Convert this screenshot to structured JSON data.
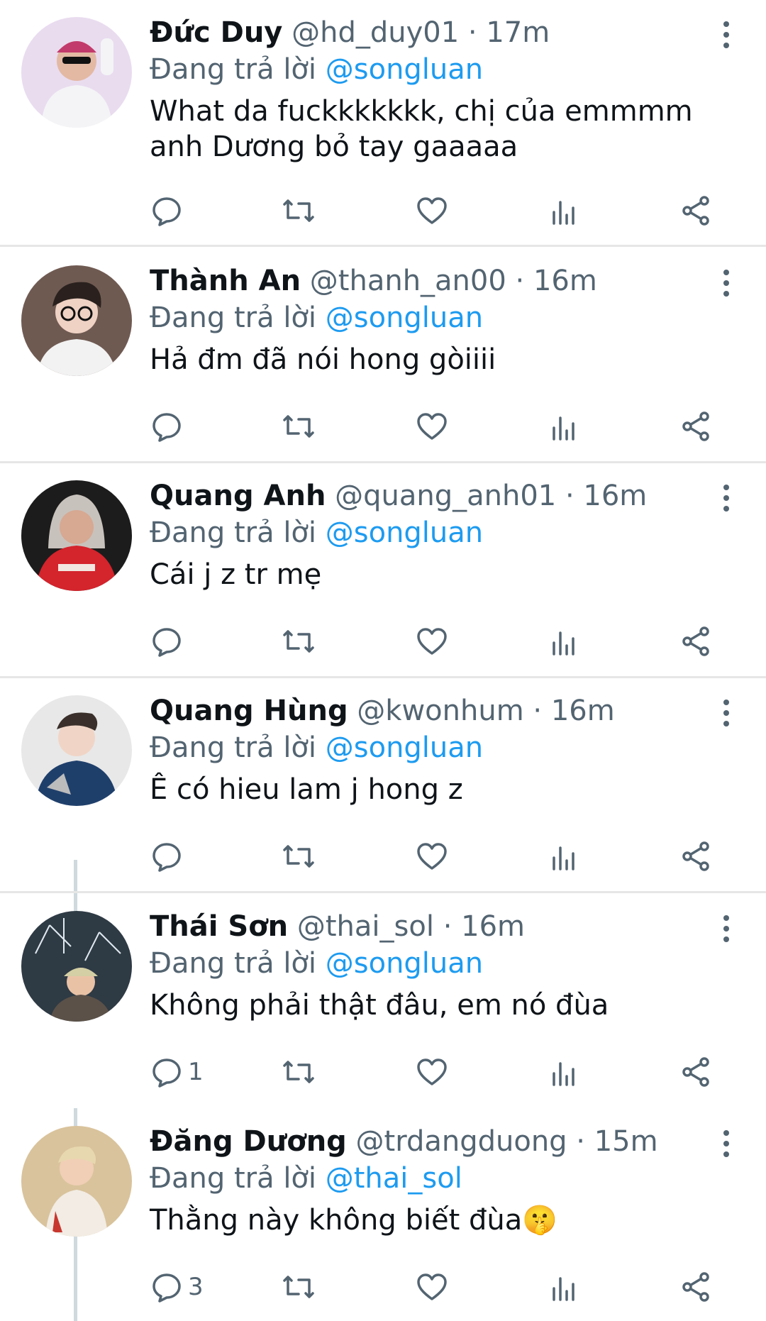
{
  "reply_prefix": "Đang trả lời",
  "tweets": [
    {
      "name": "Đức Duy",
      "handle": "@hd_duy01",
      "dot": "·",
      "time": "17m",
      "reply_to": "@songluan",
      "text": "What da fuckkkkkkk, chị của emmmm anh Dương bỏ tay gaaaaa",
      "reply_count": ""
    },
    {
      "name": "Thành An",
      "handle": "@thanh_an00",
      "dot": "·",
      "time": "16m",
      "reply_to": "@songluan",
      "text": "Hả đm đã nói hong gòiiii",
      "reply_count": ""
    },
    {
      "name": "Quang Anh",
      "handle": "@quang_anh01",
      "dot": "·",
      "time": "16m",
      "reply_to": "@songluan",
      "text": "Cái j z tr mẹ",
      "reply_count": ""
    },
    {
      "name": "Quang Hùng",
      "handle": "@kwonhum",
      "dot": "·",
      "time": "16m",
      "reply_to": "@songluan",
      "text": "Ê có hieu lam j hong z",
      "reply_count": ""
    },
    {
      "name": "Thái Sơn",
      "handle": "@thai_sol",
      "dot": "·",
      "time": "16m",
      "reply_to": "@songluan",
      "text": "Không phải thật đâu, em nó đùa",
      "reply_count": "1"
    },
    {
      "name": "Đăng Dương",
      "handle": "@trdangduong",
      "dot": "·",
      "time": "15m",
      "reply_to": "@thai_sol",
      "text": "Thằng này không biết đùa🤫",
      "reply_count": "3"
    }
  ],
  "icons": [
    "reply-icon",
    "retweet-icon",
    "like-icon",
    "views-icon",
    "share-icon",
    "more-options-icon"
  ],
  "colors": {
    "mention": "#1d9bf0",
    "secondary_text": "#536471",
    "divider": "#e6e6e6",
    "thread_line": "#cfd9de"
  }
}
